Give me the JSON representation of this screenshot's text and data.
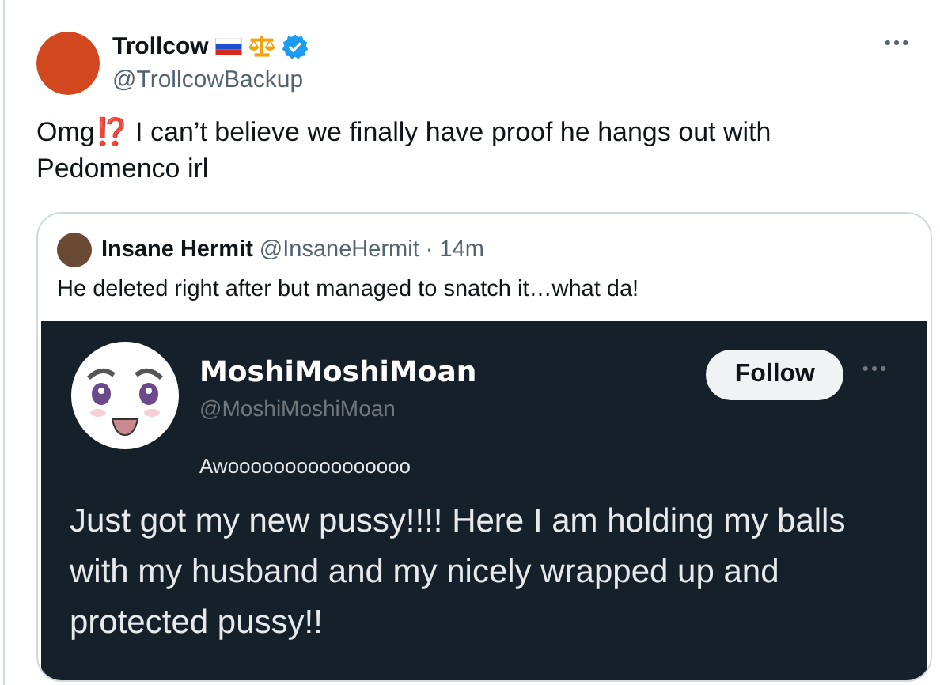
{
  "tweet": {
    "name": "Trollcow",
    "handle": "@TrollcowBackup",
    "verified": true,
    "text": "Omg⁉️ I can’t believe we finally have proof he hangs out with Pedomenco irl"
  },
  "quote": {
    "name": "Insane Hermit",
    "handle": "@InsaneHermit",
    "separator": "·",
    "time": "14m",
    "text": "He deleted right after but managed to snatch it…what da!"
  },
  "screenshot": {
    "name": "MoshiMoshiMoan",
    "handle": "@MoshiMoshiMoan",
    "follow_button": "Follow",
    "bio": "Awoooooooooooooooo",
    "text": "Just got my new pussy!!!! Here I am holding my balls with my husband and my nicely wrapped up and protected pussy!!"
  }
}
